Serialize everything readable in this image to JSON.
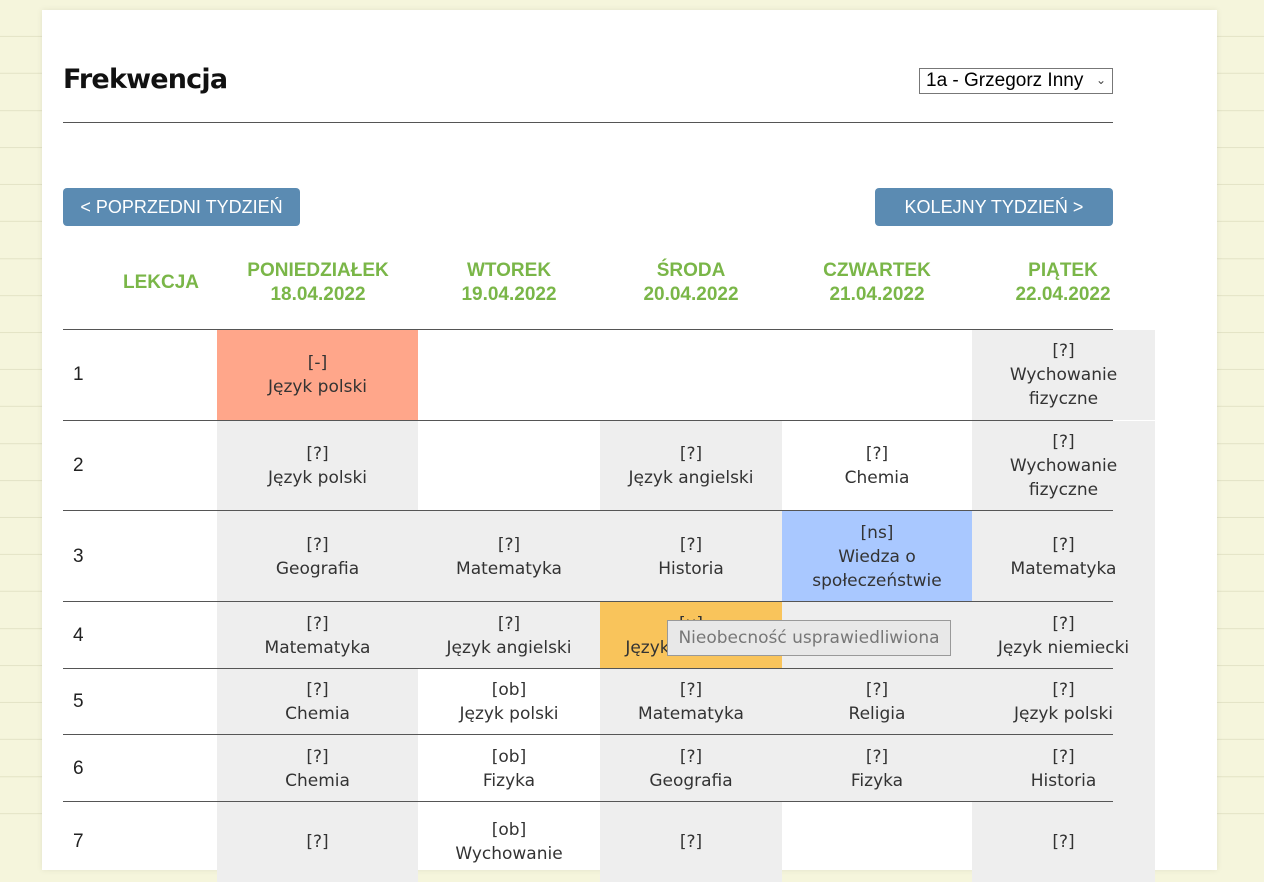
{
  "title": "Frekwencja",
  "class_select": {
    "value": "1a - Grzegorz Inny"
  },
  "nav": {
    "prev_label": "< POPRZEDNI TYDZIEŃ",
    "next_label": "KOLEJNY TYDZIEŃ >"
  },
  "table": {
    "lesson_header": "LEKCJA",
    "days": [
      {
        "name": "PONIEDZIAŁEK",
        "date": "18.04.2022"
      },
      {
        "name": "WTOREK",
        "date": "19.04.2022"
      },
      {
        "name": "ŚRODA",
        "date": "20.04.2022"
      },
      {
        "name": "CZWARTEK",
        "date": "21.04.2022"
      },
      {
        "name": "PIĄTEK",
        "date": "22.04.2022"
      }
    ],
    "rows": [
      {
        "lesson": "1",
        "cells": [
          {
            "status": "[-]",
            "subject": "Język polski",
            "color": "red"
          },
          null,
          null,
          null,
          {
            "status": "[?]",
            "subject": "Wychowanie fizyczne",
            "color": "grey"
          }
        ]
      },
      {
        "lesson": "2",
        "cells": [
          {
            "status": "[?]",
            "subject": "Język polski",
            "color": "grey"
          },
          null,
          {
            "status": "[?]",
            "subject": "Język angielski",
            "color": "grey"
          },
          {
            "status": "[?]",
            "subject": "Chemia",
            "color": "white"
          },
          {
            "status": "[?]",
            "subject": "Wychowanie fizyczne",
            "color": "grey"
          }
        ]
      },
      {
        "lesson": "3",
        "cells": [
          {
            "status": "[?]",
            "subject": "Geografia",
            "color": "grey"
          },
          {
            "status": "[?]",
            "subject": "Matematyka",
            "color": "grey"
          },
          {
            "status": "[?]",
            "subject": "Historia",
            "color": "grey"
          },
          {
            "status": "[ns]",
            "subject": "Wiedza o społeczeństwie",
            "color": "blue"
          },
          {
            "status": "[?]",
            "subject": "Matematyka",
            "color": "grey"
          }
        ]
      },
      {
        "lesson": "4",
        "cells": [
          {
            "status": "[?]",
            "subject": "Matematyka",
            "color": "grey"
          },
          {
            "status": "[?]",
            "subject": "Język angielski",
            "color": "grey"
          },
          {
            "status": "[u]",
            "subject": "Język niemiecki",
            "color": "orange"
          },
          {
            "status": "[?]",
            "subject": "",
            "color": "grey"
          },
          {
            "status": "[?]",
            "subject": "Język niemiecki",
            "color": "grey"
          }
        ]
      },
      {
        "lesson": "5",
        "cells": [
          {
            "status": "[?]",
            "subject": "Chemia",
            "color": "grey"
          },
          {
            "status": "[ob]",
            "subject": "Język polski",
            "color": "white"
          },
          {
            "status": "[?]",
            "subject": "Matematyka",
            "color": "grey"
          },
          {
            "status": "[?]",
            "subject": "Religia",
            "color": "grey"
          },
          {
            "status": "[?]",
            "subject": "Język polski",
            "color": "grey"
          }
        ]
      },
      {
        "lesson": "6",
        "cells": [
          {
            "status": "[?]",
            "subject": "Chemia",
            "color": "grey"
          },
          {
            "status": "[ob]",
            "subject": "Fizyka",
            "color": "white"
          },
          {
            "status": "[?]",
            "subject": "Geografia",
            "color": "grey"
          },
          {
            "status": "[?]",
            "subject": "Fizyka",
            "color": "grey"
          },
          {
            "status": "[?]",
            "subject": "Historia",
            "color": "grey"
          }
        ]
      },
      {
        "lesson": "7",
        "cells": [
          {
            "status": "[?]",
            "subject": "",
            "color": "grey"
          },
          {
            "status": "[ob]",
            "subject": "Wychowanie",
            "color": "white"
          },
          {
            "status": "[?]",
            "subject": "",
            "color": "grey"
          },
          null,
          {
            "status": "[?]",
            "subject": "",
            "color": "grey"
          }
        ]
      }
    ]
  },
  "tooltip": {
    "text": "Nieobecność usprawiedliwiona"
  }
}
